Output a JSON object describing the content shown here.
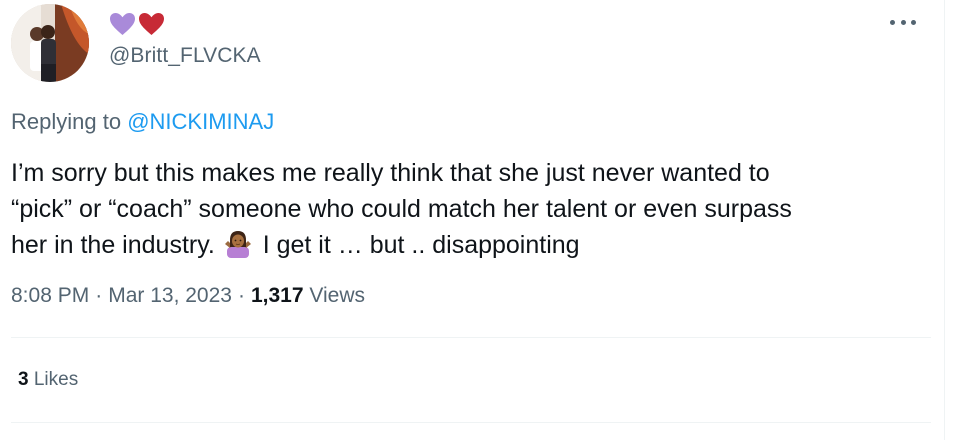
{
  "tweet": {
    "name_emojis": [
      "purple-heart",
      "red-heart"
    ],
    "handle": "@Britt_FLVCKA",
    "more_label": "More",
    "replying_prefix": "Replying to",
    "replying_to": "@NICKIMINAJ",
    "text_line1": "I’m sorry but this makes me really think that she just never wanted to",
    "text_line2": "“pick” or “coach” someone who could match her talent or even surpass",
    "text_line3_before": "her in the industry.",
    "text_line3_emoji": "person-shrugging",
    "text_line3_after": "I get it … but .. disappointing",
    "time": "8:08 PM",
    "sep": "·",
    "date": "Mar 13, 2023",
    "views_count": "1,317",
    "views_label": "Views",
    "likes_count": "3",
    "likes_label": "Likes"
  },
  "colors": {
    "text": "#0f1419",
    "secondary": "#536471",
    "link": "#1d9bf0",
    "divider": "#eff3f4",
    "purple_heart": "#a98ad9",
    "red_heart": "#c72a36"
  }
}
